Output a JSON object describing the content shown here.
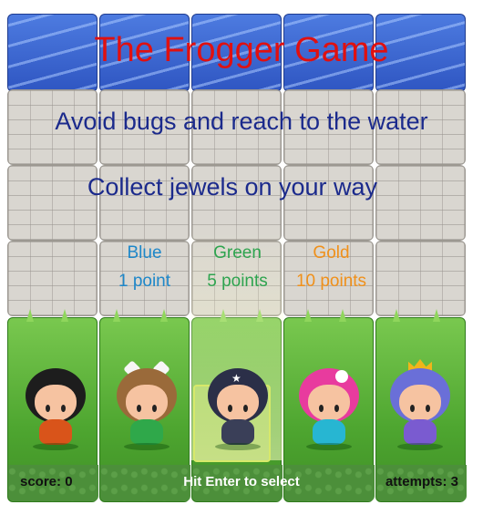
{
  "title": "The Frogger Game",
  "instructions": {
    "line1": "Avoid bugs and reach to the water",
    "line2": "Collect jewels on your way"
  },
  "jewels": [
    {
      "name": "Blue",
      "points": "1 point",
      "color": "#1e87c9"
    },
    {
      "name": "Green",
      "points": "5 points",
      "color": "#2ea44f"
    },
    {
      "name": "Gold",
      "points": "10 points",
      "color": "#f0901a"
    }
  ],
  "status": {
    "score": "score: 0",
    "hint": "Hit Enter to select",
    "attempts": "attempts: 3"
  },
  "characters": [
    {
      "name": "boy-character",
      "selected": false
    },
    {
      "name": "cat-girl-character",
      "selected": false
    },
    {
      "name": "horn-girl-character",
      "selected": true
    },
    {
      "name": "pink-girl-character",
      "selected": false
    },
    {
      "name": "princess-character",
      "selected": false
    }
  ],
  "colors": {
    "title": "#e01010",
    "instructions": "#1b2a8c",
    "water": "#3f6ed6",
    "grass": "#4ea630"
  }
}
